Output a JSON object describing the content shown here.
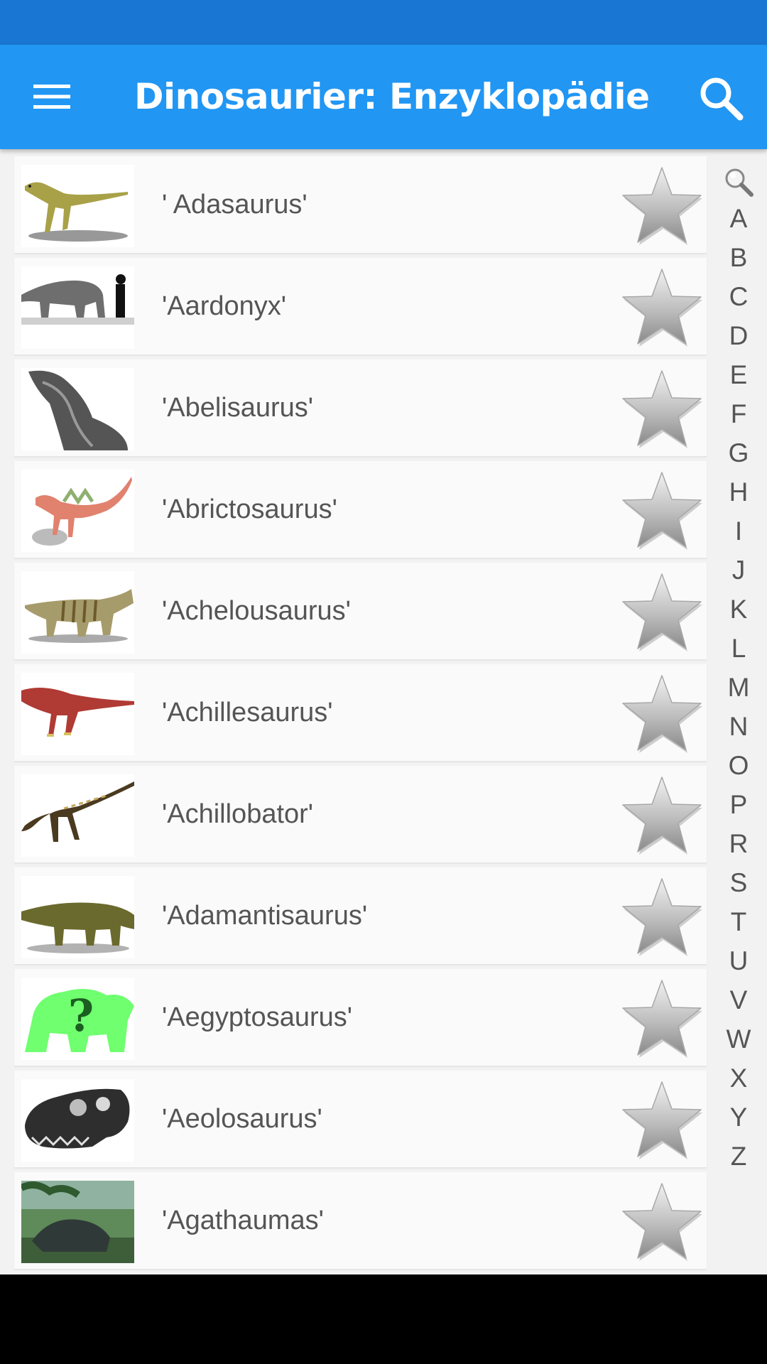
{
  "app_bar": {
    "title": "Dinosaurier: Enzyklopädie",
    "menu_icon": "hamburger-menu-icon",
    "search_icon": "search-icon",
    "background": "#2196f3",
    "status_bar_color": "#1976d2"
  },
  "dinosaurs": [
    {
      "name": "' Adasaurus'",
      "thumb": "raptor-olive"
    },
    {
      "name": "'Aardonyx'",
      "thumb": "sauropod-gray"
    },
    {
      "name": "'Abelisaurus'",
      "thumb": "skull-gray"
    },
    {
      "name": "'Abrictosaurus'",
      "thumb": "small-pink"
    },
    {
      "name": "'Achelousaurus'",
      "thumb": "ceratopsian-tan"
    },
    {
      "name": "'Achillesaurus'",
      "thumb": "theropod-red"
    },
    {
      "name": "'Achillobator'",
      "thumb": "raptor-brown"
    },
    {
      "name": "'Adamantisaurus'",
      "thumb": "quadruped-olive"
    },
    {
      "name": "'Aegyptosaurus'",
      "thumb": "unknown-green"
    },
    {
      "name": "'Aeolosaurus'",
      "thumb": "skull-dark"
    },
    {
      "name": "'Agathaumas'",
      "thumb": "painting-forest"
    }
  ],
  "index": {
    "search_icon": "magnifier-icon",
    "letters": [
      "A",
      "B",
      "C",
      "D",
      "E",
      "F",
      "G",
      "H",
      "I",
      "J",
      "K",
      "L",
      "M",
      "N",
      "O",
      "P",
      "R",
      "S",
      "T",
      "U",
      "V",
      "W",
      "X",
      "Y",
      "Z"
    ]
  },
  "icons": {
    "favorite": "star-icon"
  }
}
